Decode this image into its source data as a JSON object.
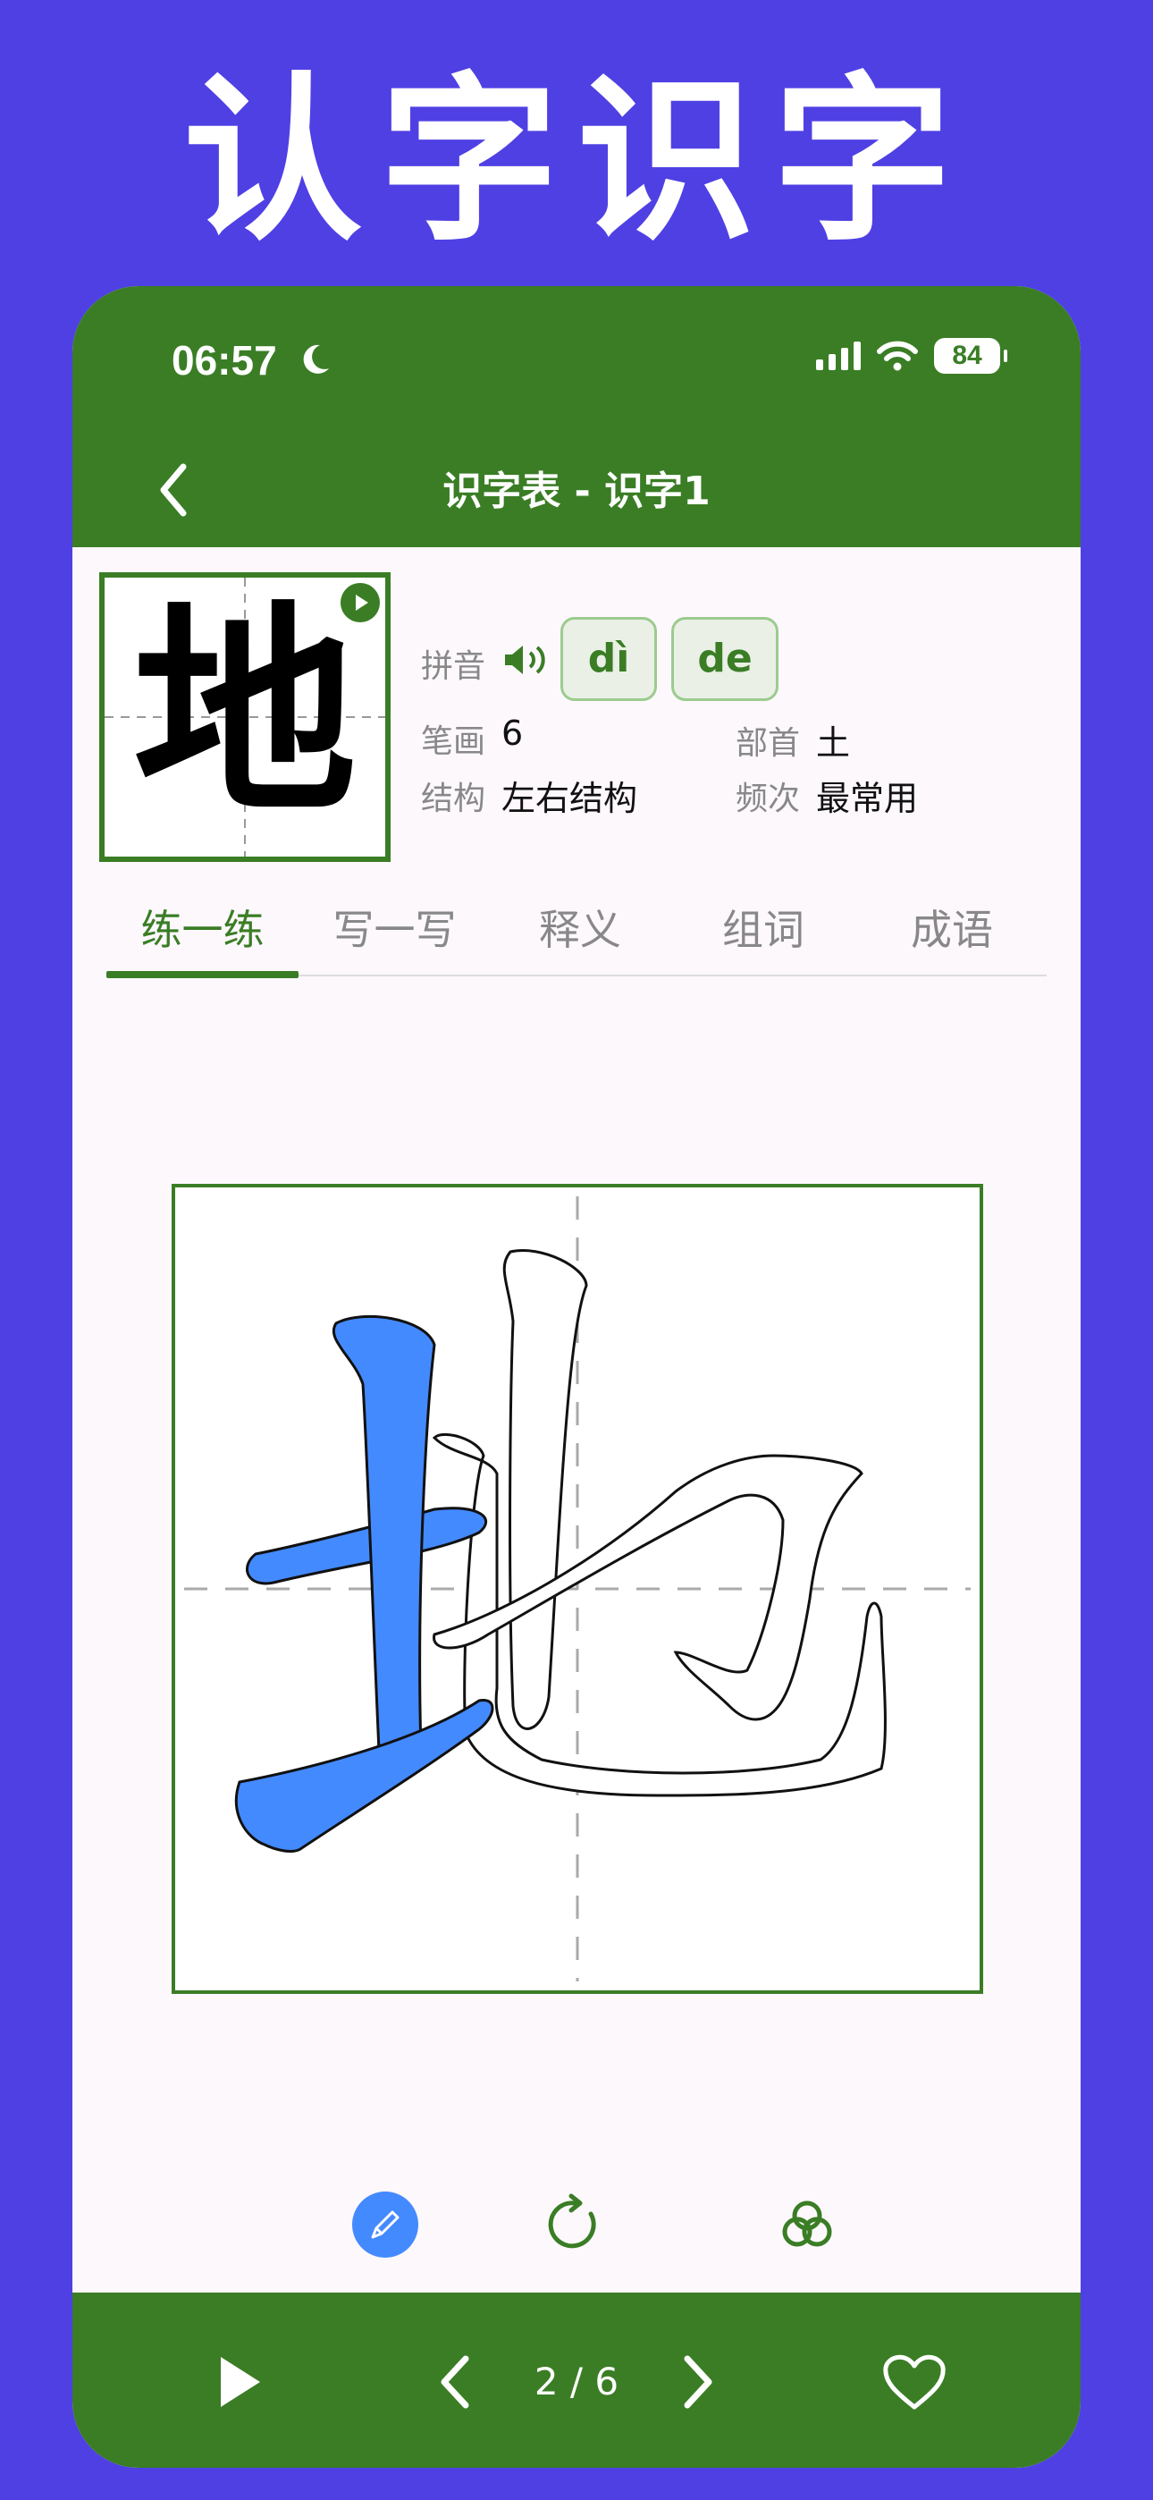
{
  "banner_title": "认字识字",
  "status": {
    "time": "06:57",
    "battery": "84"
  },
  "nav": {
    "title": "识字表 - 识字1"
  },
  "character": {
    "glyph": "地",
    "pinyin_label": "拼音",
    "pinyin": [
      "dì",
      "de"
    ],
    "strokes_label": "笔画",
    "strokes": "6",
    "radical_label": "部首",
    "radical": "土",
    "structure_label": "结构",
    "structure": "左右结构",
    "frequency_label": "频次",
    "frequency": "最常用"
  },
  "tabs": [
    "练一练",
    "写一写",
    "释义",
    "组词",
    "成语"
  ],
  "active_tab": 0,
  "pager": {
    "text": "2 / 6"
  },
  "colors": {
    "brand": "#3a7d25",
    "background": "#4f40e4",
    "stroke_highlight": "#448aff"
  }
}
